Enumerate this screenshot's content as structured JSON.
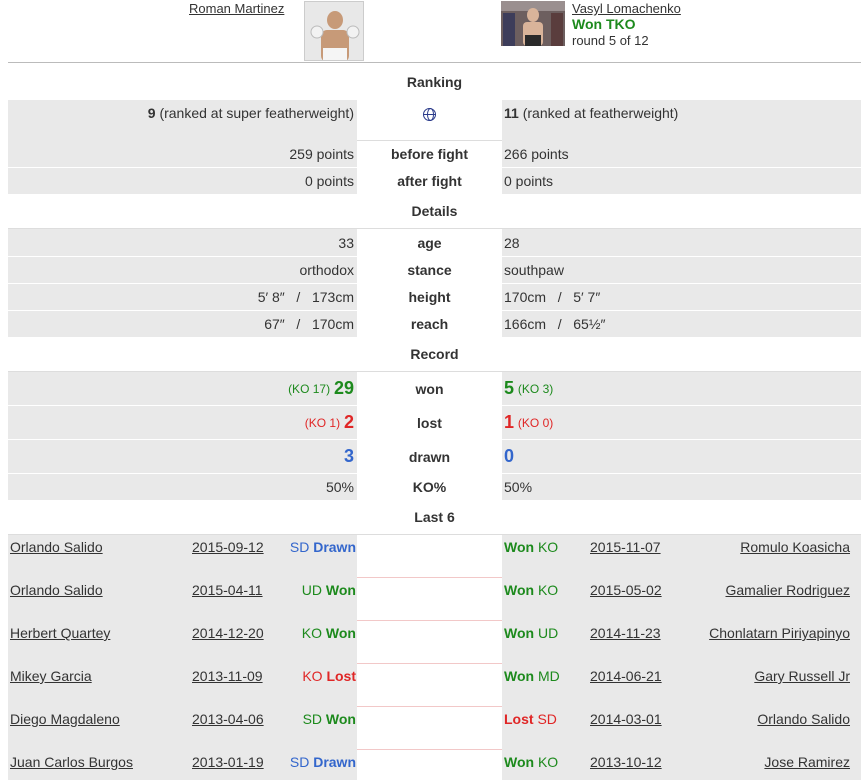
{
  "header": {
    "left_name": "Roman Martinez",
    "right_name": "Vasyl Lomachenko",
    "right_result": "Won TKO",
    "right_round": "round 5 of 12"
  },
  "sections": {
    "ranking": "Ranking",
    "details": "Details",
    "record": "Record",
    "last6": "Last 6"
  },
  "ranking": {
    "left_rank": "9",
    "left_rank_note": "(ranked at super featherweight)",
    "right_rank": "11",
    "right_rank_note": "(ranked at featherweight)",
    "before_label": "before fight",
    "before_left": "259 points",
    "before_right": "266 points",
    "after_label": "after fight",
    "after_left": "0 points",
    "after_right": "0 points"
  },
  "details": [
    {
      "label": "age",
      "left": "33",
      "right": "28"
    },
    {
      "label": "stance",
      "left": "orthodox",
      "right": "southpaw"
    },
    {
      "label": "height",
      "left": "5′ 8″   /   173cm",
      "right": "170cm   /   5′ 7″"
    },
    {
      "label": "reach",
      "left": "67″   /   170cm",
      "right": "166cm   /   65½″"
    }
  ],
  "record": {
    "won_label": "won",
    "lost_label": "lost",
    "drawn_label": "drawn",
    "ko_label": "KO%",
    "left_won_ko": "(KO 17)",
    "left_won": "29",
    "right_won": "5",
    "right_won_ko": "(KO 3)",
    "left_lost_ko": "(KO 1)",
    "left_lost": "2",
    "right_lost": "1",
    "right_lost_ko": "(KO 0)",
    "left_drawn": "3",
    "right_drawn": "0",
    "left_ko_pct": "50%",
    "right_ko_pct": "50%"
  },
  "colors": {
    "won": "#1d8a1d",
    "lost": "#e02626",
    "drawn": "#3366cc"
  },
  "last6": [
    {
      "l_opp": "Orlando Salido",
      "l_date": "2015-09-12",
      "l_method": "SD",
      "l_res": "Drawn",
      "l_color": "blue",
      "r_res": "Won",
      "r_method": "KO",
      "r_color": "green",
      "r_date": "2015-11-07",
      "r_opp": "Romulo Koasicha"
    },
    {
      "l_opp": "Orlando Salido",
      "l_date": "2015-04-11",
      "l_method": "UD",
      "l_res": "Won",
      "l_color": "green",
      "r_res": "Won",
      "r_method": "KO",
      "r_color": "green",
      "r_date": "2015-05-02",
      "r_opp": "Gamalier Rodriguez"
    },
    {
      "l_opp": "Herbert Quartey",
      "l_date": "2014-12-20",
      "l_method": "KO",
      "l_res": "Won",
      "l_color": "green",
      "r_res": "Won",
      "r_method": "UD",
      "r_color": "green",
      "r_date": "2014-11-23",
      "r_opp": "Chonlatarn Piriyapinyo"
    },
    {
      "l_opp": "Mikey Garcia",
      "l_date": "2013-11-09",
      "l_method": "KO",
      "l_res": "Lost",
      "l_color": "red",
      "r_res": "Won",
      "r_method": "MD",
      "r_color": "green",
      "r_date": "2014-06-21",
      "r_opp": "Gary Russell Jr"
    },
    {
      "l_opp": "Diego Magdaleno",
      "l_date": "2013-04-06",
      "l_method": "SD",
      "l_res": "Won",
      "l_color": "green",
      "r_res": "Lost",
      "r_method": "SD",
      "r_color": "red",
      "r_date": "2014-03-01",
      "r_opp": "Orlando Salido"
    },
    {
      "l_opp": "Juan Carlos Burgos",
      "l_date": "2013-01-19",
      "l_method": "SD",
      "l_res": "Drawn",
      "l_color": "blue",
      "r_res": "Won",
      "r_method": "KO",
      "r_color": "green",
      "r_date": "2013-10-12",
      "r_opp": "Jose Ramirez"
    }
  ]
}
